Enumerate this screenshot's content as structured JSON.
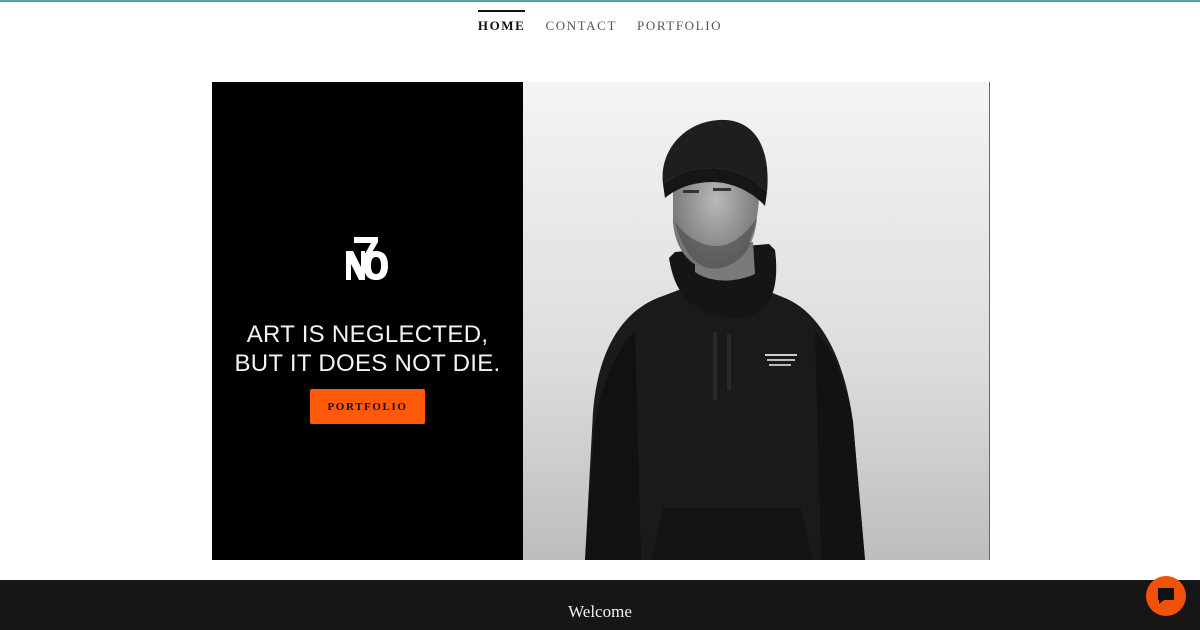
{
  "nav": {
    "items": [
      {
        "label": "HOME",
        "active": true
      },
      {
        "label": "CONTACT",
        "active": false
      },
      {
        "label": "PORTFOLIO",
        "active": false
      }
    ]
  },
  "hero": {
    "logo_text": "NO 7",
    "headline_line1": "ART IS NEGLECTED,",
    "headline_line2": "BUT IT DOES NOT DIE.",
    "cta_label": "PORTFOLIO"
  },
  "footer": {
    "welcome": "Welcome"
  },
  "chat": {
    "icon": "chat-bubble-icon"
  },
  "colors": {
    "accent": "#ff5a0a",
    "top_line": "#4aa7aa",
    "dark_band": "#161616"
  }
}
